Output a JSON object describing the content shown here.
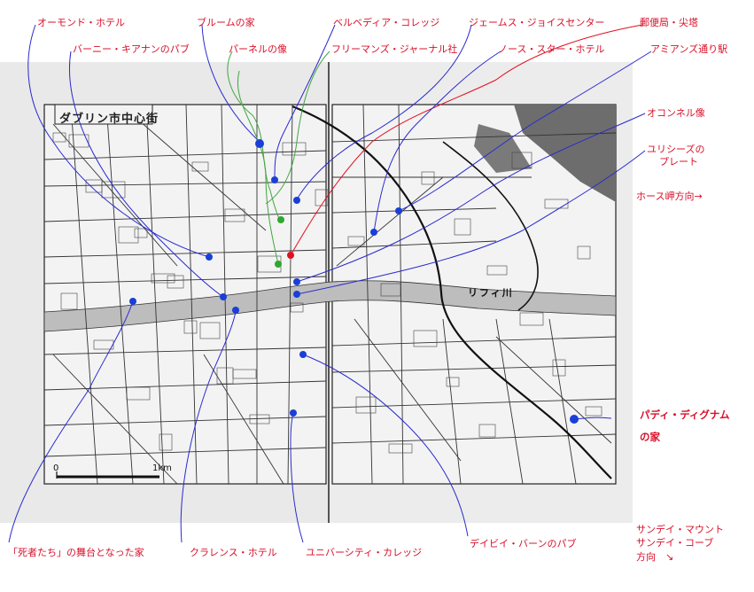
{
  "map": {
    "title": "ダブリン市中心街",
    "river_label": "リフィ川",
    "scale_zero": "0",
    "scale_km": "1km"
  },
  "annotations": {
    "ormond_hotel": "オーモンド・ホテル",
    "bloom_house": "ブルームの家",
    "belvedere_college": "ベルベディア・コレッジ",
    "james_joyce_centre": "ジェームス・ジョイスセンター",
    "post_office_spire": "郵便局・尖塔",
    "barney_kiernan_pub": "バーニー・キアナンのパブ",
    "parnell_statue": "パーネルの像",
    "freemans_journal": "フリーマンズ・ジャーナル社",
    "north_star_hotel": "ノース・スター・ホテル",
    "amiens_street_station": "アミアンズ通り駅",
    "oconnell_statue": "オコンネル像",
    "ulysses_plate_1": "ユリシーズの",
    "ulysses_plate_2": "プレート",
    "howth_direction": "ホース岬方向→",
    "paddy_dignam_1": "パディ・ディグナム",
    "paddy_dignam_2": "の家",
    "dead_setting": "「死者たち」の舞台となった家",
    "clarence_hotel": "クラレンス・ホテル",
    "university_college": "ユニバーシティ・カレッジ",
    "davy_byrnes_pub": "デイビイ・バーンのパブ",
    "sandymount_1": "サンデイ・マウント",
    "sandymount_2": "サンデイ・コーブ",
    "sandymount_3": "方向　↘"
  },
  "colors": {
    "label": "#d9102a",
    "leader_blue": "#2a2ad0",
    "leader_green": "#3fa63f",
    "leader_red": "#e01020",
    "marker_blue": "#1a3fd8",
    "marker_green": "#2fa82f",
    "marker_red": "#e01020"
  }
}
